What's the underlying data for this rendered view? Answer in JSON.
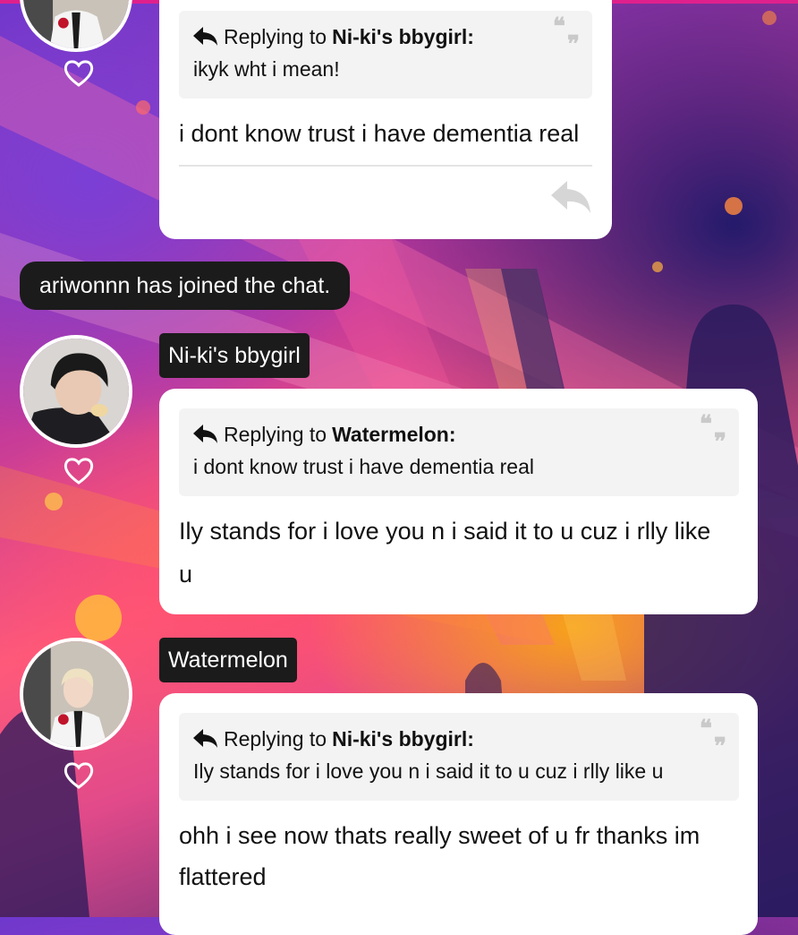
{
  "theme": {
    "accent": "#e0208c",
    "bubble_bg": "#ffffff",
    "tag_bg": "#1b1b1b",
    "quote_bg": "#f3f3f3"
  },
  "messages": [
    {
      "reply_label": "Replying to",
      "reply_to": "Ni-ki's bbygirl:",
      "quoted": "ikyk wht i mean!",
      "text": "i dont know trust i have dementia real",
      "avatar_icon": "avatar-photo"
    },
    {
      "author": "Ni-ki's bbygirl",
      "reply_label": "Replying to",
      "reply_to": "Watermelon:",
      "quoted": "i dont know trust i have dementia real",
      "text_line1": "Ily stands for i love you n i said it to u cuz i rlly like",
      "text_line2": "u"
    },
    {
      "author": "Watermelon",
      "reply_label": "Replying to",
      "reply_to": "Ni-ki's bbygirl:",
      "quoted": "Ily stands for i love you n i said it to u cuz i rlly like u",
      "text_line1": "ohh i see now thats really sweet of u fr thanks im",
      "text_line2": "flattered"
    }
  ],
  "system": {
    "join_notice": "ariwonnn has joined the chat."
  },
  "icons": {
    "like": "heart-icon",
    "reply": "reply-arrow-icon",
    "quote": "quote-mark-icon"
  }
}
